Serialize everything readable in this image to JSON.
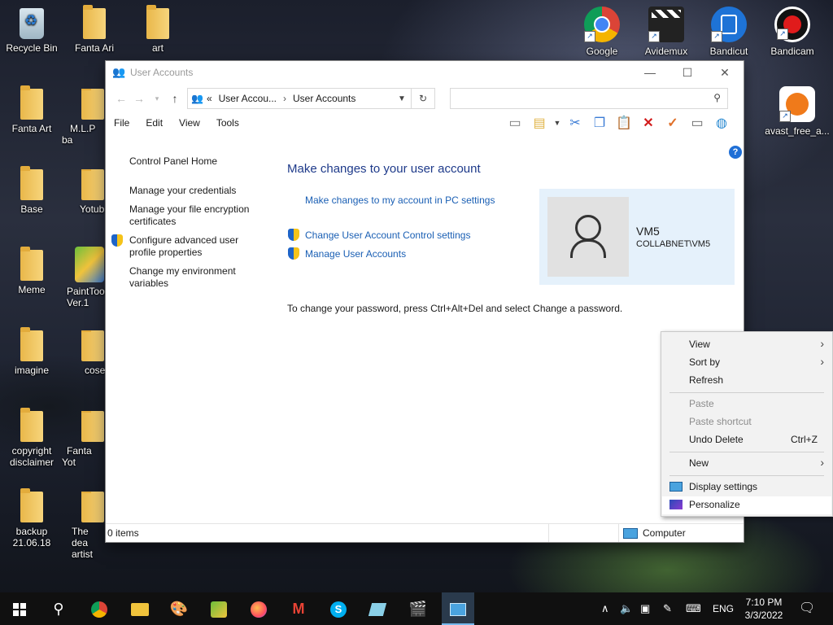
{
  "desktop_icons": [
    {
      "label": "Recycle Bin",
      "kind": "bin",
      "icon": "recycle-bin-icon"
    },
    {
      "label": "Fanta Ari",
      "kind": "folder",
      "icon": "folder-icon"
    },
    {
      "label": "art",
      "kind": "folder",
      "icon": "folder-icon"
    },
    {
      "label": "Fanta Art",
      "kind": "folder",
      "icon": "folder-icon"
    },
    {
      "label": "M.L.P ba",
      "kind": "folder",
      "icon": "folder-icon"
    },
    {
      "label": "Base",
      "kind": "folder",
      "icon": "folder-icon"
    },
    {
      "label": "Yotub",
      "kind": "folder",
      "icon": "folder-icon"
    },
    {
      "label": "Meme",
      "kind": "folder",
      "icon": "folder-icon"
    },
    {
      "label": "PaintTool Ver.1",
      "kind": "app",
      "icon": "painttool-icon"
    },
    {
      "label": "imagine",
      "kind": "folder",
      "icon": "folder-icon"
    },
    {
      "label": "cose",
      "kind": "folder",
      "icon": "folder-icon"
    },
    {
      "label": "copyright disclaimer",
      "kind": "folder",
      "icon": "folder-icon"
    },
    {
      "label": "Fanta Yot",
      "kind": "folder",
      "icon": "folder-icon"
    },
    {
      "label": "backup 21.06.18",
      "kind": "folder",
      "icon": "folder-icon"
    },
    {
      "label": "The dea artist",
      "kind": "folder",
      "icon": "folder-icon"
    },
    {
      "label": "Google",
      "kind": "app",
      "icon": "chrome-icon",
      "color": "#db4437"
    },
    {
      "label": "Avidemux",
      "kind": "app",
      "icon": "clapperboard-icon",
      "color": "#222222"
    },
    {
      "label": "Bandicut",
      "kind": "app",
      "icon": "bandicut-icon",
      "color": "#1e73d6"
    },
    {
      "label": "Bandicam",
      "kind": "app",
      "icon": "bandicam-icon",
      "color": "#e01b1b"
    },
    {
      "label": "avast_free_a...",
      "kind": "app",
      "icon": "avast-icon",
      "color": "#f07a1a"
    }
  ],
  "window": {
    "title": "User Accounts",
    "controls": {
      "minimize": "—",
      "maximize": "☐",
      "close": "✕"
    },
    "address": {
      "overflow": "«",
      "crumbs": [
        "User Accou...",
        "User Accounts"
      ],
      "separator": "›"
    },
    "search_placeholder": "",
    "menu": [
      "File",
      "Edit",
      "View",
      "Tools"
    ],
    "left_pane": {
      "home": "Control Panel Home",
      "links": [
        {
          "label": "Manage your credentials"
        },
        {
          "label": "Manage your file encryption certificates"
        },
        {
          "label": "Configure advanced user profile properties"
        },
        {
          "label": "Change my environment variables"
        }
      ]
    },
    "main": {
      "title": "Make changes to your user account",
      "pc_settings_link": "Make changes to my account in PC settings",
      "uac_link": "Change User Account Control settings",
      "manage_link": "Manage User Accounts",
      "password_note": "To change your password, press Ctrl+Alt+Del and select Change a password."
    },
    "user": {
      "name": "VM5",
      "domain": "COLLABNET\\VM5"
    },
    "status": {
      "items": "0 items",
      "location": "Computer"
    }
  },
  "context_menu": {
    "items": [
      {
        "label": "View",
        "submenu": true,
        "enabled": true
      },
      {
        "label": "Sort by",
        "submenu": true,
        "enabled": true
      },
      {
        "label": "Refresh",
        "enabled": true
      },
      {
        "label": "Paste",
        "enabled": false
      },
      {
        "label": "Paste shortcut",
        "enabled": false
      },
      {
        "label": "Undo Delete",
        "shortcut": "Ctrl+Z",
        "enabled": true
      },
      {
        "label": "New",
        "submenu": true,
        "enabled": true
      },
      {
        "label": "Display settings",
        "enabled": true,
        "icon": "display-icon"
      },
      {
        "label": "Personalize",
        "enabled": true,
        "icon": "personalize-icon",
        "highlighted": true
      }
    ]
  },
  "taskbar": {
    "language": "ENG",
    "time": "7:10 PM",
    "date": "3/3/2022",
    "accent": "#76b9ed"
  }
}
